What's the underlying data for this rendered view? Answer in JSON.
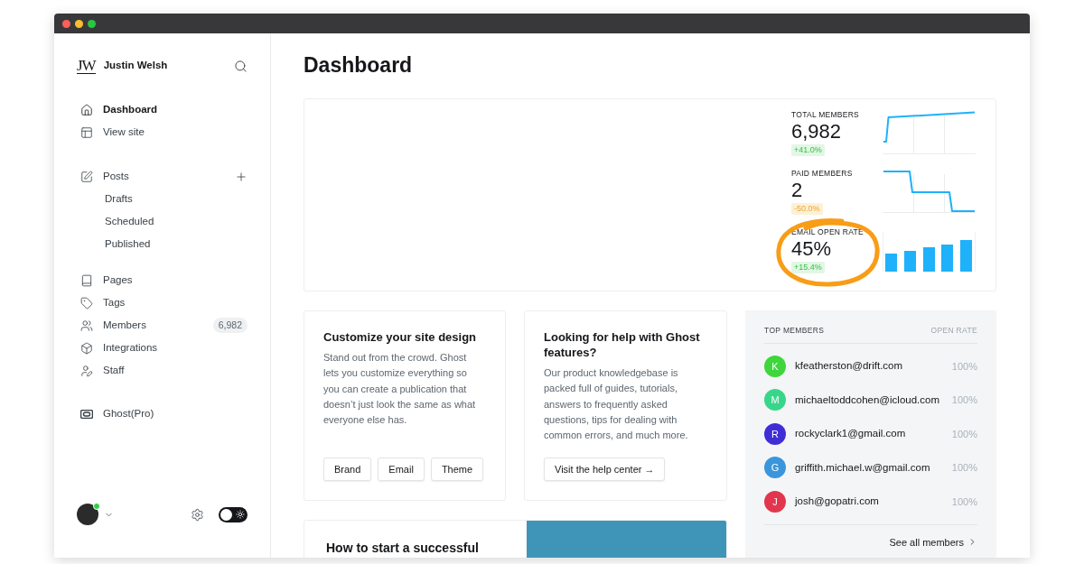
{
  "sidebar": {
    "brand": {
      "logo": "JW",
      "name": "Justin Welsh"
    },
    "sections": [
      {
        "items": [
          {
            "label": "Dashboard",
            "selected": true
          },
          {
            "label": "View site",
            "selected": false
          }
        ]
      },
      {
        "items": [
          {
            "label": "Posts",
            "selected": false,
            "children": [
              {
                "label": "Drafts",
                "selected": false
              },
              {
                "label": "Scheduled",
                "selected": false
              },
              {
                "label": "Published",
                "selected": false
              }
            ]
          }
        ]
      },
      {
        "items": [
          {
            "label": "Pages",
            "selected": false
          },
          {
            "label": "Tags",
            "selected": false
          },
          {
            "label": "Members",
            "selected": false,
            "badge": "6,982"
          },
          {
            "label": "Integrations",
            "selected": false
          },
          {
            "label": "Staff",
            "selected": false
          }
        ]
      },
      {
        "items": [
          {
            "label": "Ghost(Pro)",
            "selected": false
          }
        ]
      }
    ],
    "user": {
      "online": true
    },
    "theme_toggle": {
      "on": false
    }
  },
  "main": {
    "title": "Dashboard",
    "stats": [
      {
        "label": "TOTAL MEMBERS",
        "value": "6,982",
        "change": {
          "text": "+41.0%",
          "kind": "increase"
        },
        "kind": "line"
      },
      {
        "label": "PAID MEMBERS",
        "value": "2",
        "change": {
          "text": "-50.0%",
          "kind": "decrease"
        },
        "kind": "line"
      },
      {
        "label": "EMAIL OPEN RATE",
        "value": "45%",
        "change": {
          "text": "+15.4%",
          "kind": "increase"
        },
        "kind": "bar"
      }
    ],
    "cards": [
      {
        "title": "Customize your site design",
        "text": "Stand out from the crowd. Ghost lets you customize everything so you can create a publication that doesn’t just look the same as what everyone else has.",
        "buttons": [
          "Brand",
          "Email",
          "Theme"
        ]
      },
      {
        "title": "Looking for help with Ghost features?",
        "text": "Our product knowledgebase is packed full of guides, tutorials, answers to frequently asked questions, tips for dealing with common errors, and much more.",
        "buttons": [
          "Visit the help center →"
        ]
      }
    ],
    "top_members": {
      "title": "TOP MEMBERS",
      "column": "OPEN RATE",
      "rows": [
        {
          "initial": "K",
          "email": "kfeatherston@drift.com",
          "rate": "100%",
          "color": "#3fd63c"
        },
        {
          "initial": "M",
          "email": "michaeltoddcohen@icloud.com",
          "rate": "100%",
          "color": "#38d68a"
        },
        {
          "initial": "R",
          "email": "rockyclark1@gmail.com",
          "rate": "100%",
          "color": "#3f2dd6"
        },
        {
          "initial": "G",
          "email": "griffith.michael.w@gmail.com",
          "rate": "100%",
          "color": "#3a96db"
        },
        {
          "initial": "J",
          "email": "josh@gopatri.com",
          "rate": "100%",
          "color": "#e2364e"
        }
      ],
      "link": "See all members"
    },
    "featured_post": {
      "title": "How to start a successful"
    }
  }
}
